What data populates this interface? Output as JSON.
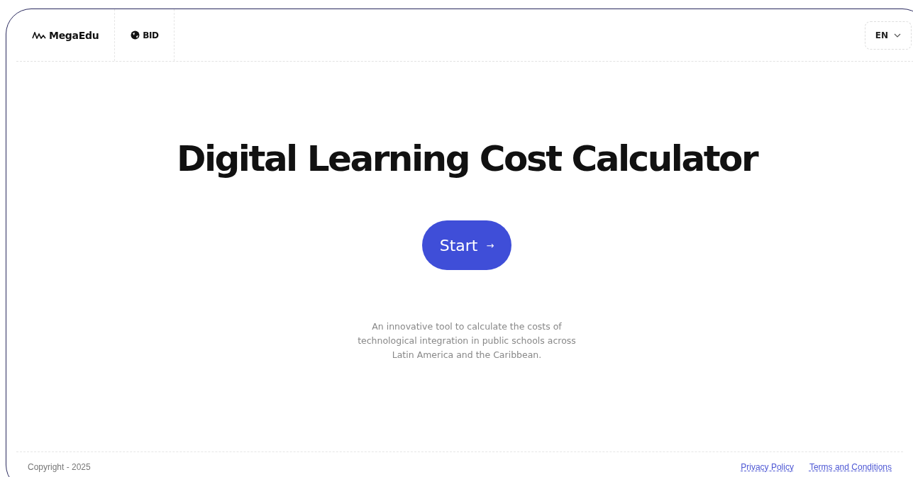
{
  "header": {
    "logos": [
      {
        "kind": "megaedu",
        "label": "MegaEdu"
      },
      {
        "kind": "bid",
        "label": "BID"
      }
    ],
    "language": {
      "label": "EN"
    }
  },
  "hero": {
    "title": "Digital Learning Cost Calculator",
    "start_button": {
      "label": "Start",
      "arrow": "→"
    },
    "description": "An innovative tool to calculate the costs of technological integration in public schools across Latin America and the Caribbean."
  },
  "footer": {
    "copyright": "Copyright - 2025",
    "links": [
      "Privacy Policy",
      "Terms and Conditions"
    ]
  }
}
